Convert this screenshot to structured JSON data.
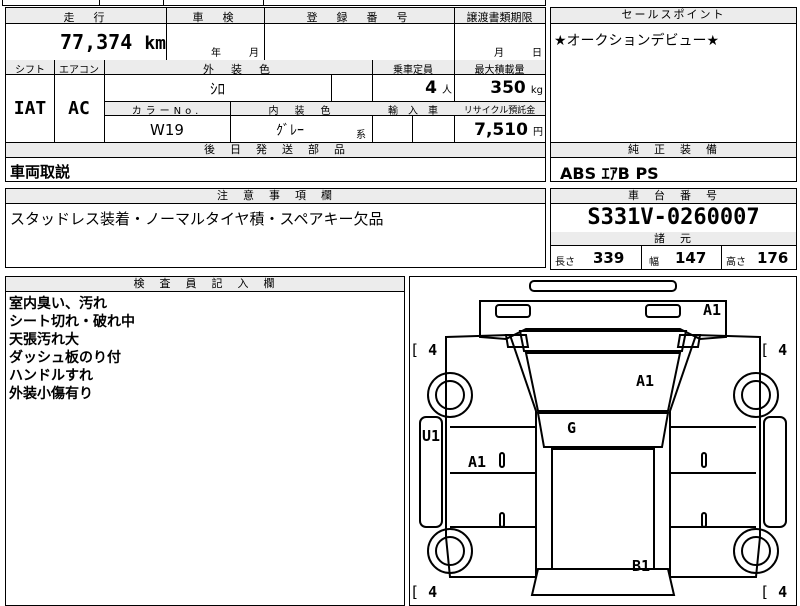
{
  "top_partial": [
    "",
    ""
  ],
  "mileage": {
    "header": "走　行",
    "value": "77,374",
    "unit": "km"
  },
  "inspection": {
    "header": "車　検",
    "year": "年",
    "month": "月"
  },
  "registration": {
    "header": "登　録　番　号",
    "value": ""
  },
  "transfer_deadline": {
    "header": "譲渡書類期限",
    "month": "月",
    "day": "日"
  },
  "sales_point": {
    "header": "セールスポイント",
    "text": "★オークションデビュー★"
  },
  "shift": {
    "header": "シフト",
    "value": "IAT"
  },
  "aircon": {
    "header": "エアコン",
    "value": "AC"
  },
  "exterior_color": {
    "header": "外　装　色",
    "value": "ｼﾛ"
  },
  "capacity": {
    "header": "乗車定員",
    "value": "4",
    "unit": "人"
  },
  "max_load": {
    "header": "最大積載量",
    "value": "350",
    "unit": "kg"
  },
  "color_no": {
    "header": "カラーNo.",
    "value": "W19"
  },
  "interior_color": {
    "header": "内　装　色",
    "value": "ｸﾞﾚｰ",
    "suffix": "系"
  },
  "import": {
    "header": "輸　入　車",
    "value": ""
  },
  "recycle": {
    "header": "リサイクル預託金",
    "value": "7,510",
    "unit": "円"
  },
  "later_parts": {
    "header": "後　日　発　送　部　品",
    "value": "車両取説"
  },
  "genuine_equipment": {
    "header": "純　正　装　備",
    "value": "ABS ｴｱB PS"
  },
  "notes": {
    "header": "注　意　事　項　欄",
    "value": "スタッドレス装着・ノーマルタイヤ積・スペアキー欠品"
  },
  "chassis": {
    "header": "車　台　番　号",
    "value": "S331V-0260007"
  },
  "specs": {
    "header": "諸　元",
    "length_label": "長さ",
    "length": "339",
    "width_label": "幅",
    "width": "147",
    "height_label": "高さ",
    "height": "176"
  },
  "inspector": {
    "header": "検　査　員　記　入　欄",
    "lines": [
      "室内臭い、汚れ",
      "シート切れ・破れ中",
      "天張汚れ大",
      "ダッシュ板のり付",
      "ハンドルすれ",
      "外装小傷有り"
    ]
  },
  "diagram": {
    "marks": {
      "roof_right": "A1",
      "windshield": "A1",
      "roof": "G",
      "left_side": "A1",
      "left_panel": "U1",
      "rear": "B1"
    },
    "tires": {
      "fl": "4",
      "fr": "4",
      "rl": "4",
      "rr": "4"
    }
  }
}
